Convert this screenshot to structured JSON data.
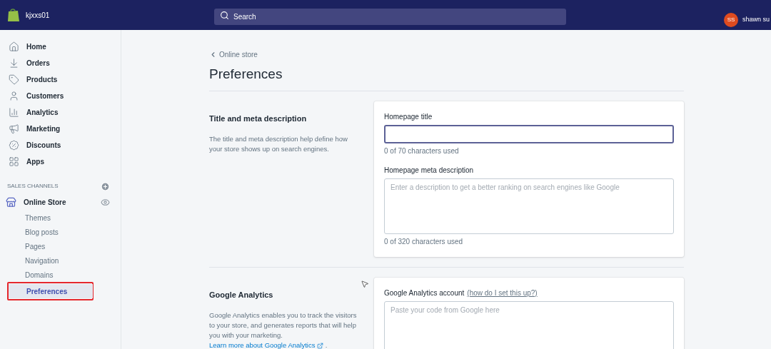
{
  "topbar": {
    "store_name": "kjxxs01",
    "search": {
      "placeholder": "Search"
    },
    "user": {
      "initials": "SS",
      "name": "shawn su"
    }
  },
  "sidebar": {
    "items": [
      {
        "label": "Home",
        "selected": false
      },
      {
        "label": "Orders",
        "selected": false
      },
      {
        "label": "Products",
        "selected": false
      },
      {
        "label": "Customers",
        "selected": false
      },
      {
        "label": "Analytics",
        "selected": false
      },
      {
        "label": "Marketing",
        "selected": false
      },
      {
        "label": "Discounts",
        "selected": false
      },
      {
        "label": "Apps",
        "selected": false
      }
    ],
    "sales_channels": {
      "heading": "SALES CHANNELS",
      "channel": {
        "label": "Online Store",
        "sub_items": [
          {
            "label": "Themes",
            "selected": false,
            "highlighted": false
          },
          {
            "label": "Blog posts",
            "selected": false,
            "highlighted": false
          },
          {
            "label": "Pages",
            "selected": false,
            "highlighted": false
          },
          {
            "label": "Navigation",
            "selected": false,
            "highlighted": false
          },
          {
            "label": "Domains",
            "selected": false,
            "highlighted": false
          },
          {
            "label": "Preferences",
            "selected": true,
            "highlighted": true
          }
        ]
      }
    }
  },
  "page": {
    "breadcrumb": "Online store",
    "title": "Preferences",
    "sections": [
      {
        "title": "Title and meta description",
        "description": "The title and meta description help define how your store shows up on search engines.",
        "fields": [
          {
            "kind": "input",
            "label": "Homepage title",
            "focused": true,
            "help": "0 of 70 characters used"
          },
          {
            "kind": "textarea",
            "label": "Homepage meta description",
            "placeholder": "Enter a description to get a better ranking on search engines like Google",
            "focused": false,
            "help": "0 of 320 characters used"
          }
        ]
      },
      {
        "title": "Google Analytics",
        "description": "Google Analytics enables you to track the visitors to your store, and generates reports that will help you with your marketing.",
        "link": "Learn more about Google Analytics",
        "suffix": ".",
        "fields": [
          {
            "kind": "textarea",
            "label": "Google Analytics account",
            "label_link": "(how do I set this up?)",
            "placeholder": "Paste your code from Google here",
            "focused": false
          }
        ]
      }
    ]
  }
}
